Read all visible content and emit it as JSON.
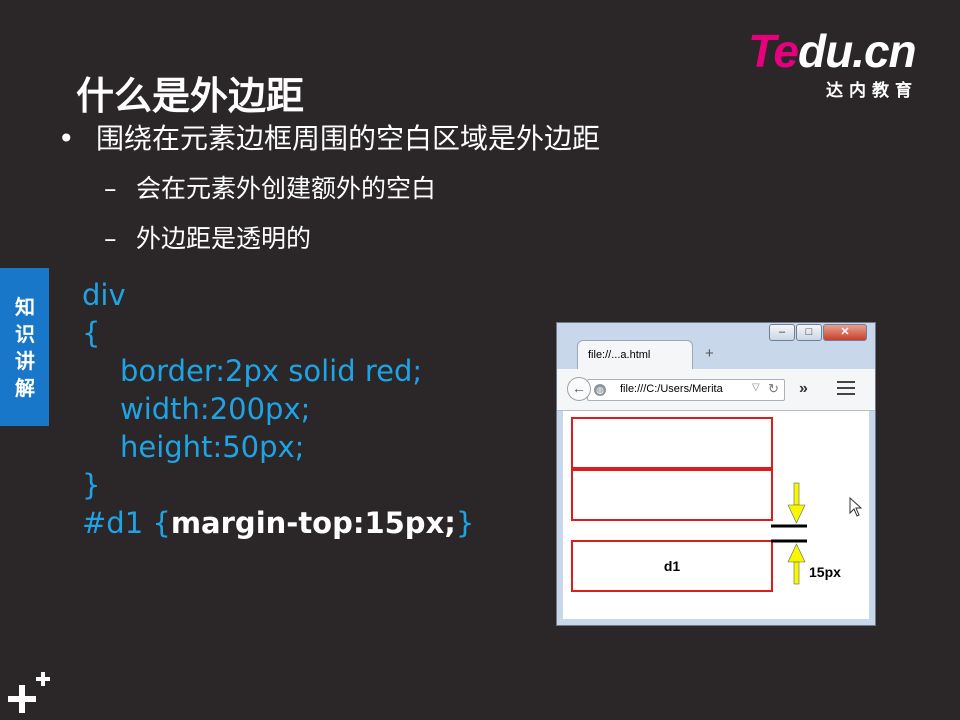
{
  "logo": {
    "brand_pink": "Te",
    "brand_white": "du.cn",
    "tagline": "达内教育"
  },
  "slide": {
    "title": "什么是外边距",
    "bullets": [
      {
        "marker": "•",
        "text": "围绕在元素边框周围的空白区域是外边距"
      },
      {
        "marker": "–",
        "text": "会在元素外创建额外的空白"
      },
      {
        "marker": "–",
        "text": "外边距是透明的"
      }
    ],
    "side_tab": "知识讲解",
    "code": {
      "line1": "div",
      "line2": "{",
      "line3": "border:2px solid red;",
      "line4": "width:200px;",
      "line5": "height:50px;",
      "line6": "}",
      "line7_selector": "#d1 ",
      "line7_open": "{",
      "line7_rule": "margin-top:15px;",
      "line7_close": "}"
    }
  },
  "browser": {
    "tab_title": "file://...a.html",
    "new_tab": "+",
    "url": "file:///C:/Users/Merita",
    "window_buttons": {
      "minimize": "‒",
      "maximize": "□",
      "close": "✕"
    },
    "boxes": [
      {
        "label": ""
      },
      {
        "label": ""
      },
      {
        "label": "d1"
      }
    ],
    "margin_label": "15px"
  },
  "colors": {
    "background": "#2b2627",
    "accent_blue": "#1ea4e6",
    "side_tab": "#1877c9",
    "logo_pink": "#e6007e",
    "box_border": "#e01b1b",
    "arrow_yellow": "#f7f700"
  },
  "icons": [
    "globe-icon",
    "back-arrow-icon",
    "reload-icon",
    "dropdown-icon",
    "overflow-chevron-icon",
    "hamburger-menu-icon",
    "cursor-icon",
    "plus-decoration-icon"
  ]
}
